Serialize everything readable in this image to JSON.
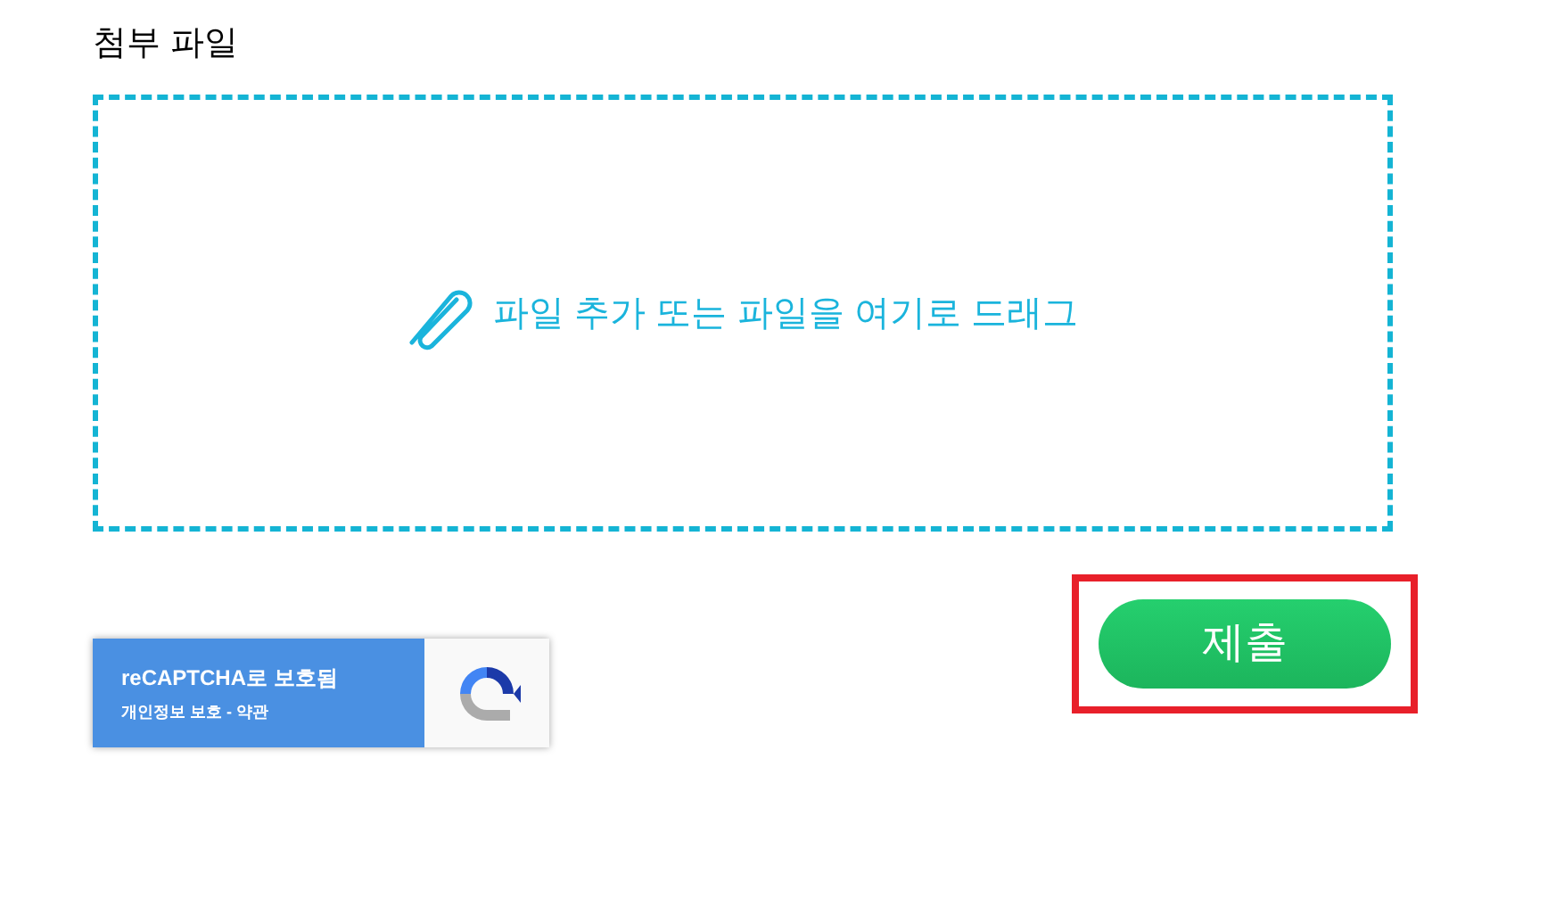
{
  "attachment": {
    "label": "첨부 파일",
    "dropzone_text": "파일 추가 또는 파일을 여기로 드래그"
  },
  "recaptcha": {
    "title": "reCAPTCHA로 보호됨",
    "links": "개인정보 보호 - 약관"
  },
  "submit": {
    "label": "제출",
    "highlighted": true
  }
}
